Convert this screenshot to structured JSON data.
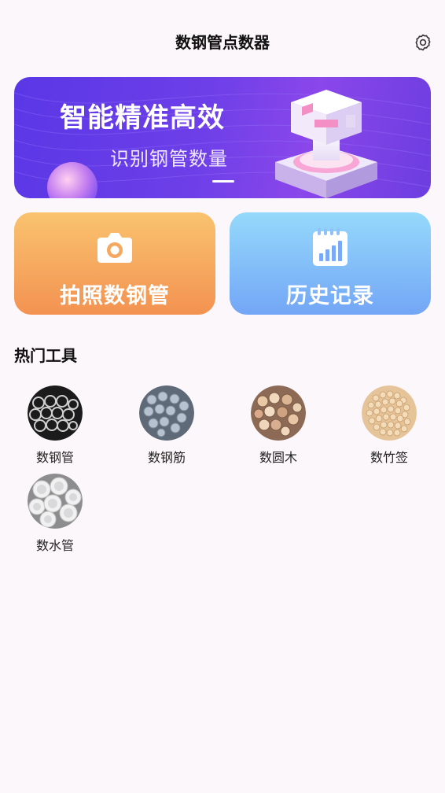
{
  "header": {
    "title": "数钢管点数器",
    "settings_icon": "gear-icon"
  },
  "banner": {
    "headline": "智能精准高效",
    "subtitle": "识别钢管数量"
  },
  "actions": {
    "photo": {
      "label": "拍照数钢管",
      "icon": "camera-icon",
      "colors": [
        "#f9c36f",
        "#f39251"
      ]
    },
    "history": {
      "label": "历史记录",
      "icon": "calendar-chart-icon",
      "colors": [
        "#95d9fb",
        "#73a6f6"
      ]
    }
  },
  "tools": {
    "title": "热门工具",
    "items": [
      {
        "label": "数钢管",
        "icon": "steel-pipe-icon"
      },
      {
        "label": "数钢筋",
        "icon": "rebar-icon"
      },
      {
        "label": "数圆木",
        "icon": "log-icon"
      },
      {
        "label": "数竹签",
        "icon": "bamboo-stick-icon"
      },
      {
        "label": "数水管",
        "icon": "water-pipe-icon"
      }
    ]
  }
}
